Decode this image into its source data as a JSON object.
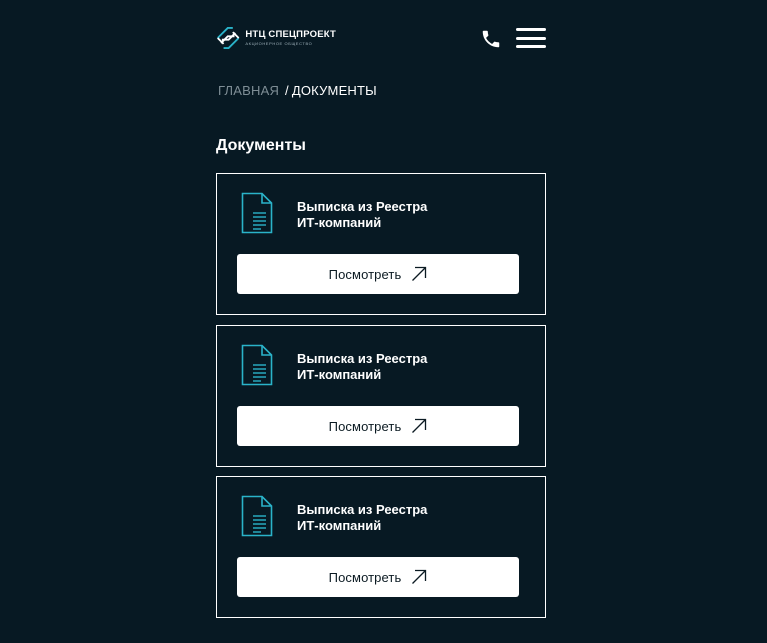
{
  "header": {
    "logo_title": "НТЦ СПЕЦПРОЕКТ",
    "logo_subtitle": "АКЦИОНЕРНОЕ ОБЩЕСТВО",
    "phone_icon": "phone-icon",
    "menu_icon": "hamburger-menu-icon"
  },
  "breadcrumb": {
    "home": "ГЛАВНАЯ",
    "separator": "/",
    "current": "ДОКУМЕНТЫ"
  },
  "page_title": "Документы",
  "documents": [
    {
      "title_line1": "Выписка из Реестра",
      "title_line2": "ИТ-компаний",
      "button_label": "Посмотреть",
      "icon": "document-icon"
    },
    {
      "title_line1": "Выписка из Реестра",
      "title_line2": "ИТ-компаний",
      "button_label": "Посмотреть",
      "icon": "document-icon"
    },
    {
      "title_line1": "Выписка из Реестра",
      "title_line2": "ИТ-компаний",
      "button_label": "Посмотреть",
      "icon": "document-icon"
    }
  ],
  "colors": {
    "background": "#071923",
    "accent": "#2ab3c9",
    "text": "#ffffff",
    "breadcrumb_muted": "#7e8d95"
  }
}
